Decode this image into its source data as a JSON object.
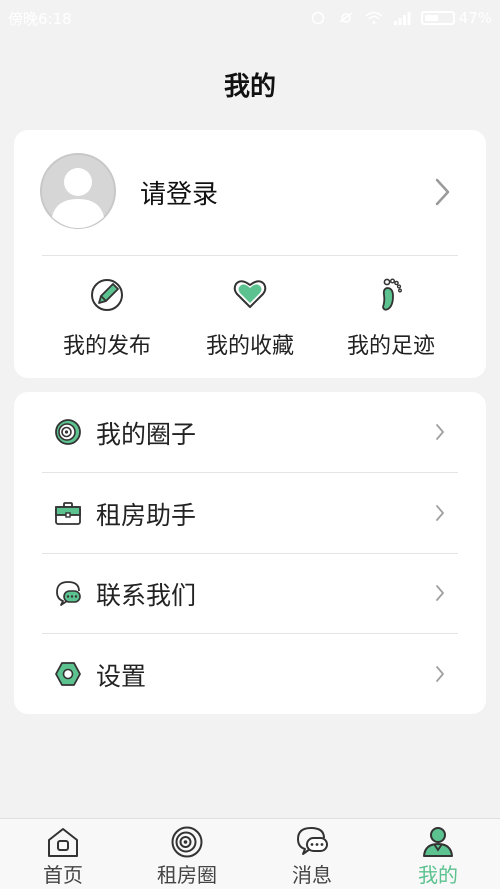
{
  "status_bar": {
    "carrier_time": "傍晚6:18",
    "battery": "47%"
  },
  "header": {
    "title": "我的"
  },
  "profile": {
    "login_label": "请登录"
  },
  "quick_actions": [
    {
      "label": "我的发布",
      "icon": "edit-icon"
    },
    {
      "label": "我的收藏",
      "icon": "heart-icon"
    },
    {
      "label": "我的足迹",
      "icon": "footprint-icon"
    }
  ],
  "menu": [
    {
      "label": "我的圈子",
      "icon": "circle-target-icon"
    },
    {
      "label": "租房助手",
      "icon": "briefcase-icon"
    },
    {
      "label": "联系我们",
      "icon": "chat-icon"
    },
    {
      "label": "设置",
      "icon": "settings-hex-icon"
    }
  ],
  "tabbar": [
    {
      "label": "首页",
      "icon": "home-icon"
    },
    {
      "label": "租房圈",
      "icon": "target-icon"
    },
    {
      "label": "消息",
      "icon": "message-icon"
    },
    {
      "label": "我的",
      "icon": "user-icon",
      "active": true
    }
  ],
  "colors": {
    "accent": "#5cc28f",
    "background": "#f2f2f2",
    "card": "#ffffff"
  }
}
